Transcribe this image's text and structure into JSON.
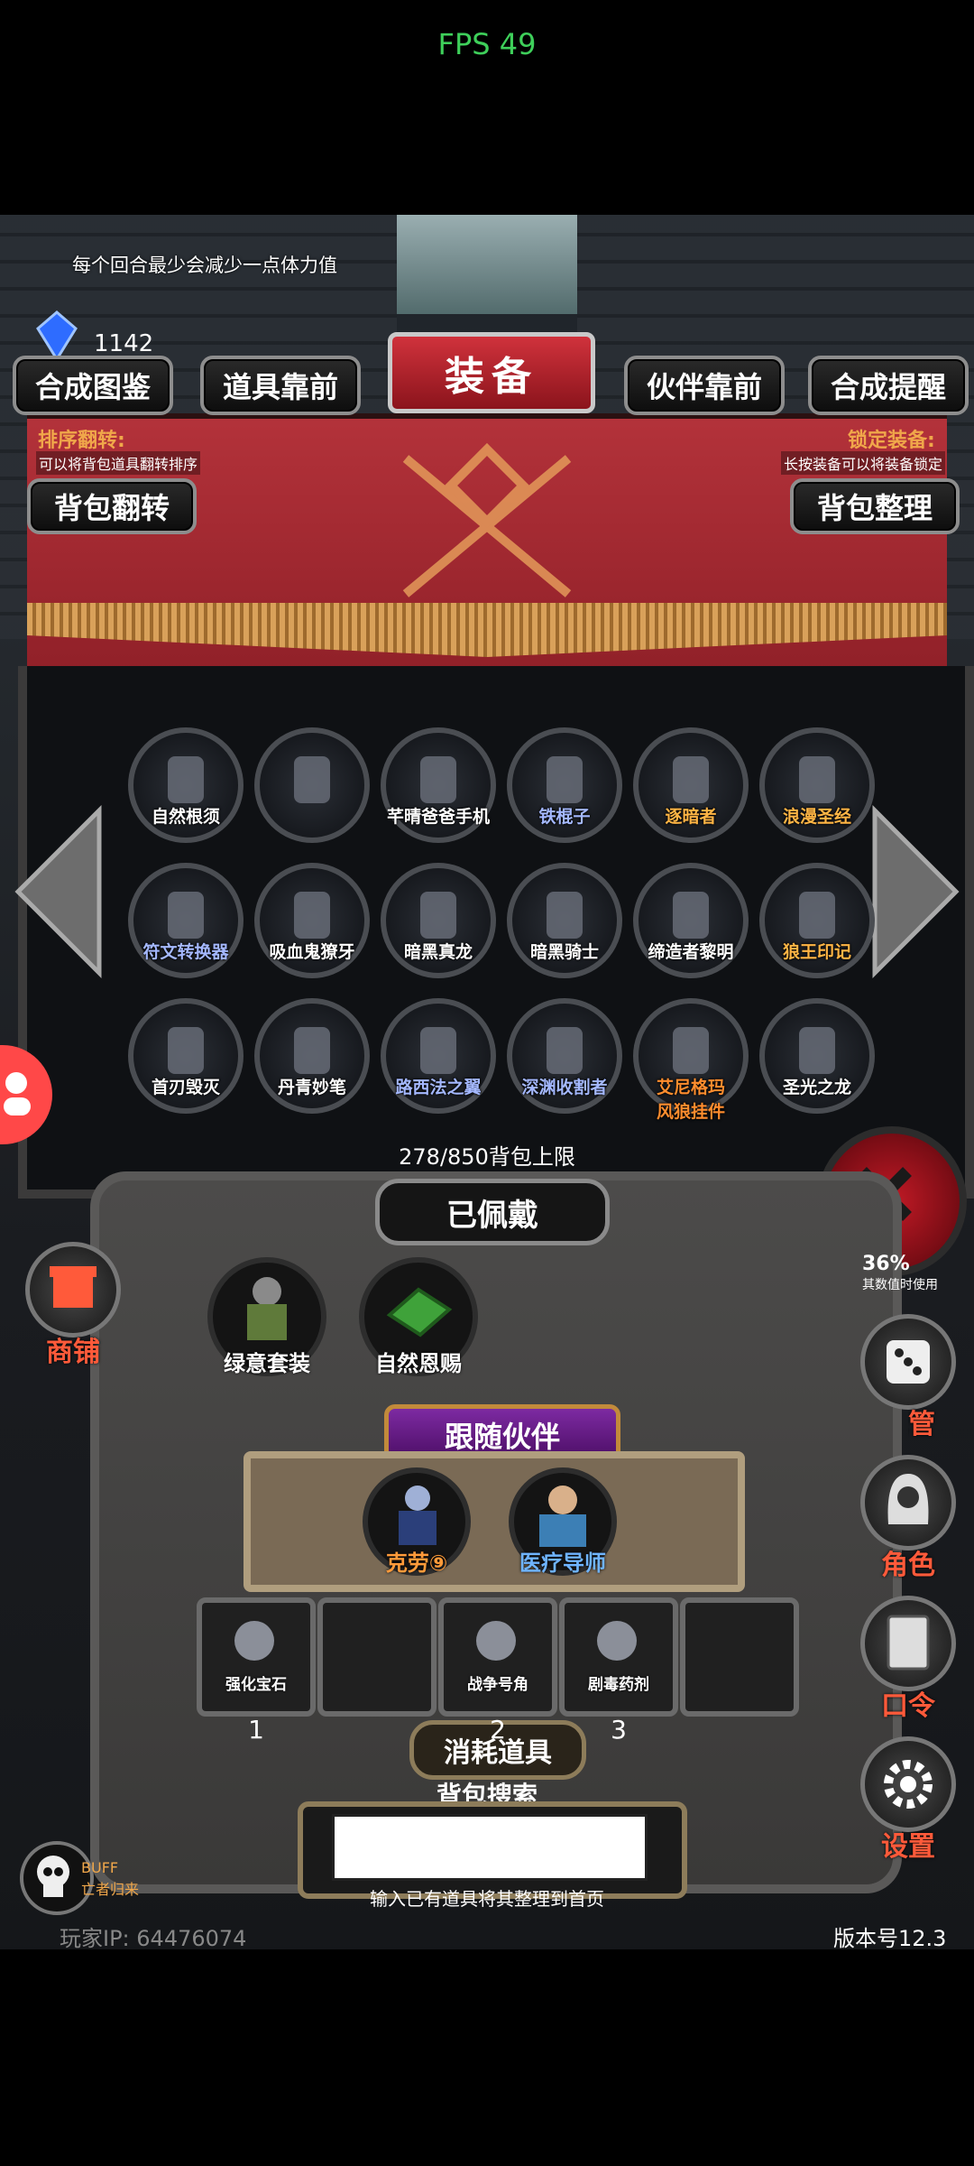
{
  "status": {
    "fps": "FPS 49"
  },
  "header": {
    "note": "每个回合最少会减少一点体力值",
    "gem_count": "1142",
    "title": "装备",
    "tabs": [
      "合成图鉴",
      "道具靠前",
      "伙伴靠前",
      "合成提醒"
    ]
  },
  "banner": {
    "left_hint_title": "排序翻转:",
    "left_hint_sub": "可以将背包道具翻转排序",
    "right_hint_title": "锁定装备:",
    "right_hint_sub": "长按装备可以将装备锁定",
    "left_button": "背包翻转",
    "right_button": "背包整理"
  },
  "bag": {
    "items": [
      {
        "label": "自然根须",
        "quality": "white",
        "icon": "green-boots-icon"
      },
      {
        "label": "",
        "quality": "white",
        "icon": "locked-chain-icon"
      },
      {
        "label": "芊晴爸爸手机",
        "quality": "white",
        "icon": "phone-icon"
      },
      {
        "label": "铁棍子",
        "quality": "blue",
        "icon": "iron-rod-icon"
      },
      {
        "label": "逐暗者",
        "quality": "orange",
        "icon": "ice-sword-icon"
      },
      {
        "label": "浪漫圣经",
        "quality": "orange",
        "icon": "bible-book-icon"
      },
      {
        "label": "符文转换器",
        "quality": "blue",
        "icon": "rune-converter-icon"
      },
      {
        "label": "吸血鬼獠牙",
        "quality": "white",
        "icon": "vampire-fang-icon"
      },
      {
        "label": "暗黑真龙",
        "quality": "white",
        "icon": "dark-dragon-icon"
      },
      {
        "label": "暗黑骑士",
        "quality": "white",
        "icon": "dark-knight-icon"
      },
      {
        "label": "缔造者黎明",
        "quality": "white",
        "icon": "dawn-blade-icon"
      },
      {
        "label": "狼王印记",
        "quality": "orange",
        "icon": "wolf-mark-icon"
      },
      {
        "label": "首刃毁灭",
        "quality": "white",
        "icon": "destroyer-blade-icon"
      },
      {
        "label": "丹青妙笔",
        "quality": "white",
        "icon": "brush-icon"
      },
      {
        "label": "路西法之翼",
        "quality": "blue",
        "icon": "lucifer-wing-icon"
      },
      {
        "label": "深渊收割者",
        "quality": "blue",
        "icon": "abyss-reaper-icon"
      },
      {
        "label": "艾尼格玛\n风狼挂件",
        "quality": "red",
        "icon": "wind-wolf-pendant-icon"
      },
      {
        "label": "圣光之龙",
        "quality": "white",
        "icon": "holy-dragon-icon"
      }
    ],
    "limit_text": "278/850背包上限"
  },
  "equipped": {
    "title": "已佩戴",
    "items": [
      {
        "label": "绿意套装",
        "icon": "green-armor-icon"
      },
      {
        "label": "自然恩赐",
        "icon": "nature-gift-icon"
      }
    ],
    "right_note_value": "36%",
    "right_note": "其数值时使用"
  },
  "partners": {
    "title": "跟随伙伴",
    "items": [
      {
        "label": "克劳⑨",
        "icon": "keluo-partner-icon"
      },
      {
        "label": "医疗导师",
        "icon": "medic-mentor-icon"
      }
    ]
  },
  "consumables": {
    "title": "消耗道具",
    "items": [
      {
        "label": "强化宝石",
        "count": "1",
        "icon": "enhance-gem-icon"
      },
      {
        "label": "",
        "count": "",
        "icon": ""
      },
      {
        "label": "战争号角",
        "count": "2",
        "icon": "war-horn-icon"
      },
      {
        "label": "剧毒药剂",
        "count": "3",
        "icon": "poison-potion-icon"
      },
      {
        "label": "",
        "count": "",
        "icon": ""
      }
    ]
  },
  "search": {
    "title": "背包搜索",
    "placeholder": "",
    "hint": "输入已有道具将其整理到首页"
  },
  "sidebar_left": {
    "shop": "商铺"
  },
  "sidebar_right": {
    "dice": "托管",
    "role": "角色",
    "code": "口令",
    "settings": "设置"
  },
  "buff": {
    "label": "BUFF",
    "sub": "亡者归来"
  },
  "footer": {
    "player_ip_label": "玩家IP:",
    "player_ip": "64476074",
    "version": "版本号12.3"
  },
  "colors": {
    "banner_red": "#a92731",
    "accent_orange": "#f0a74a",
    "fps_green": "#3ecf5a"
  }
}
